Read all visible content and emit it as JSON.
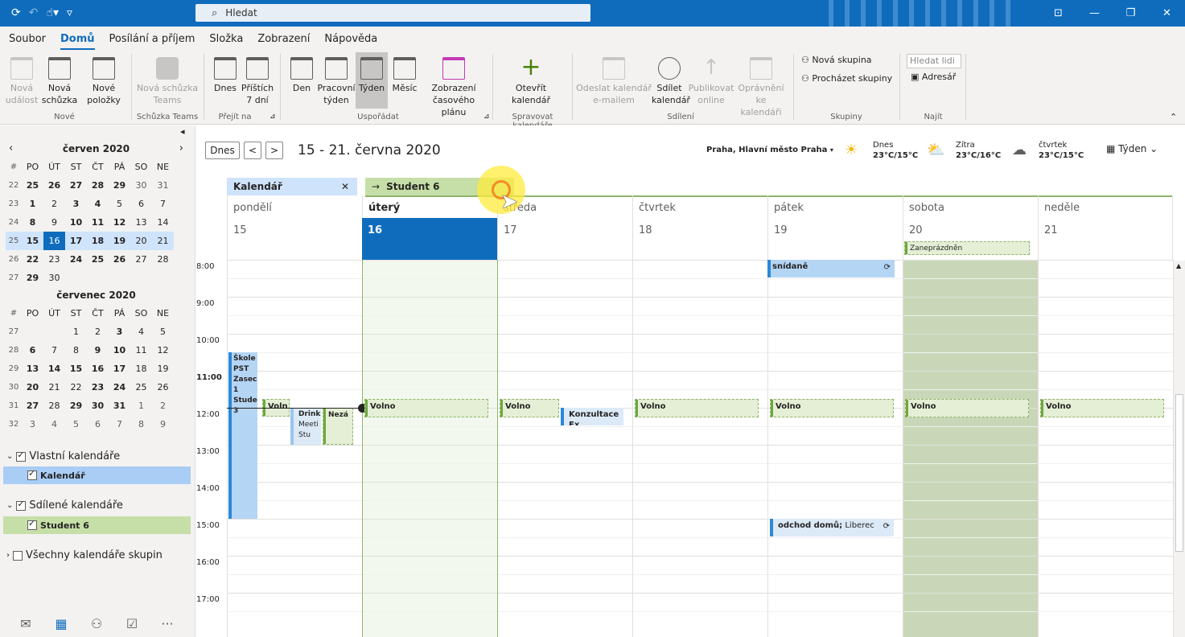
{
  "titlebar": {
    "search_placeholder": "Hledat",
    "icons": [
      "refresh-icon",
      "undo-icon",
      "touch-icon",
      "dropdown-icon"
    ],
    "window_buttons": [
      "restore-layout",
      "minimize",
      "maximize",
      "close"
    ]
  },
  "menu": {
    "items": [
      "Soubor",
      "Domů",
      "Posílání a příjem",
      "Složka",
      "Zobrazení",
      "Nápověda"
    ],
    "active": "Domů"
  },
  "ribbon": {
    "nove": {
      "label": "Nové",
      "new_event": "Nová\nudálost",
      "new_meeting": "Nová\nschůzka",
      "new_items": "Nové\npoložky"
    },
    "teams": {
      "label": "Schůzka Teams",
      "new_teams": "Nová schůzka\nTeams"
    },
    "goto": {
      "label": "Přejít na",
      "today": "Dnes",
      "next7": "Příštích\n7 dní"
    },
    "arrange": {
      "label": "Uspořádat",
      "day": "Den",
      "workweek": "Pracovní\ntýden",
      "week": "Týden",
      "month": "Měsíc",
      "schedule": "Zobrazení\nčasového plánu"
    },
    "manage": {
      "label": "Spravovat kalendáře",
      "open": "Otevřít\nkalendář"
    },
    "share": {
      "label": "Sdílení",
      "email": "Odeslat kalendář\ne-mailem",
      "share": "Sdílet\nkalendář",
      "publish": "Publikovat\nonline",
      "perms": "Oprávnění\nke kalendáři"
    },
    "groups": {
      "label": "Skupiny",
      "new_group": "Nová skupina",
      "browse": "Procházet skupiny"
    },
    "find": {
      "label": "Najít",
      "search_people": "Hledat lidi",
      "address_book": "Adresář"
    }
  },
  "minical": {
    "june": {
      "title": "červen 2020",
      "headers": [
        "#",
        "PO",
        "ÚT",
        "ST",
        "ČT",
        "PÁ",
        "SO",
        "NE"
      ],
      "rows": [
        [
          "22",
          "25",
          "26",
          "27",
          "28",
          "29",
          "30",
          "31"
        ],
        [
          "23",
          "1",
          "2",
          "3",
          "4",
          "5",
          "6",
          "7"
        ],
        [
          "24",
          "8",
          "9",
          "10",
          "11",
          "12",
          "13",
          "14"
        ],
        [
          "25",
          "15",
          "16",
          "17",
          "18",
          "19",
          "20",
          "21"
        ],
        [
          "26",
          "22",
          "23",
          "24",
          "25",
          "26",
          "27",
          "28"
        ],
        [
          "27",
          "29",
          "30",
          "",
          "",
          "",
          "",
          ""
        ]
      ]
    },
    "july": {
      "title": "červenec 2020",
      "headers": [
        "#",
        "PO",
        "ÚT",
        "ST",
        "ČT",
        "PÁ",
        "SO",
        "NE"
      ],
      "rows": [
        [
          "27",
          "",
          "",
          "1",
          "2",
          "3",
          "4",
          "5"
        ],
        [
          "28",
          "6",
          "7",
          "8",
          "9",
          "10",
          "11",
          "12"
        ],
        [
          "29",
          "13",
          "14",
          "15",
          "16",
          "17",
          "18",
          "19"
        ],
        [
          "30",
          "20",
          "21",
          "22",
          "23",
          "24",
          "25",
          "26"
        ],
        [
          "31",
          "27",
          "28",
          "29",
          "30",
          "31",
          "1",
          "2"
        ],
        [
          "32",
          "3",
          "4",
          "5",
          "6",
          "7",
          "8",
          "9"
        ]
      ]
    }
  },
  "calendars": {
    "own_label": "Vlastní kalendáře",
    "own_item": "Kalendář",
    "shared_label": "Sdílené kalendáře",
    "shared_item": "Student 6",
    "groups_label": "Všechny kalendáře skupin"
  },
  "toolbar": {
    "today": "Dnes",
    "prev": "<",
    "next": ">",
    "range": "15 - 21. června 2020",
    "location": "Praha, Hlavní město Praha",
    "view": "Týden",
    "weather": [
      {
        "day": "Dnes",
        "temp": "23°C/15°C"
      },
      {
        "day": "Zítra",
        "temp": "23°C/16°C"
      },
      {
        "day": "čtvrtek",
        "temp": "23°C/15°C"
      }
    ]
  },
  "tabs": {
    "calendar": "Kalendář",
    "student": "Student 6"
  },
  "days": [
    {
      "name": "pondělí",
      "num": "15"
    },
    {
      "name": "úterý",
      "num": "16"
    },
    {
      "name": "středa",
      "num": "17"
    },
    {
      "name": "čtvrtek",
      "num": "18"
    },
    {
      "name": "pátek",
      "num": "19"
    },
    {
      "name": "sobota",
      "num": "20"
    },
    {
      "name": "neděle",
      "num": "21"
    }
  ],
  "hours": [
    "8:00",
    "9:00",
    "10:00",
    "11:00",
    "12:00",
    "13:00",
    "14:00",
    "15:00",
    "16:00",
    "17:00"
  ],
  "events": {
    "busy": "Zaneprázdněn",
    "free": "Volno",
    "breakfast": "snídaně",
    "school": "Škole PST Zasec 1 Stude 3",
    "free_short": "Voln",
    "drink": "Drink",
    "drink_sub": "Meeti Stu",
    "neza": "Nezá",
    "konzultace": "Konzultace Ex",
    "odchod": "odchod domů;",
    "odchod_loc": "Liberec"
  },
  "colors": {
    "accent": "#0f6cbd",
    "student": "#c6dfa8",
    "calendar": "#cfe4fa"
  }
}
